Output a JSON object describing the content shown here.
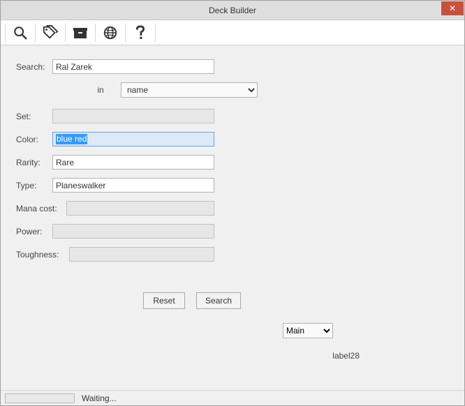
{
  "window": {
    "title": "Deck Builder"
  },
  "toolbar": {
    "icons": {
      "search": "search-icon",
      "tags": "tags-icon",
      "box": "archive-icon",
      "globe": "globe-icon",
      "help": "help-icon"
    }
  },
  "form": {
    "search": {
      "label": "Search:",
      "value": "Ral Zarek"
    },
    "in": {
      "label": "in",
      "value": "name"
    },
    "set": {
      "label": "Set:",
      "value": ""
    },
    "color": {
      "label": "Color:",
      "value": "blue red"
    },
    "rarity": {
      "label": "Rarity:",
      "value": "Rare"
    },
    "type": {
      "label": "Type:",
      "value": "Planeswalker"
    },
    "manacost": {
      "label": "Mana cost:",
      "value": ""
    },
    "power": {
      "label": "Power:",
      "value": ""
    },
    "toughness": {
      "label": "Toughness:",
      "value": ""
    }
  },
  "buttons": {
    "reset": "Reset",
    "search": "Search"
  },
  "side": {
    "deck_select": "Main",
    "label28": "label28"
  },
  "status": {
    "text": "Waiting..."
  }
}
